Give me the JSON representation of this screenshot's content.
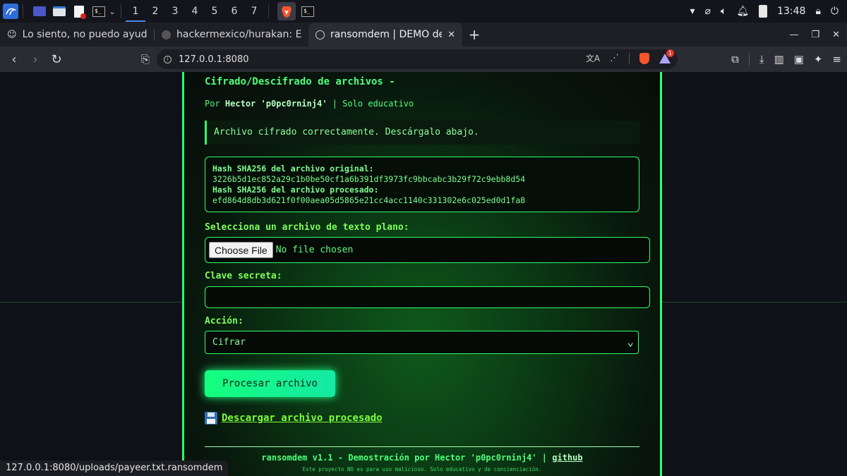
{
  "taskbar": {
    "workspaces": [
      "1",
      "2",
      "3",
      "4",
      "5",
      "6",
      "7"
    ],
    "clock": "13:48"
  },
  "tabs": [
    {
      "label": "Lo siento, no puedo ayudar co",
      "icon": "bot-icon"
    },
    {
      "label": "hackermexico/hurakan: Es un",
      "icon": "github-icon"
    },
    {
      "label": "ransomdem | DEMO de cif",
      "icon": "globe-icon",
      "active": true
    }
  ],
  "address": {
    "url": "127.0.0.1:8080",
    "notification_count": "1"
  },
  "page": {
    "title": "Cifrado/Descifrado de archivos -",
    "by_prefix": "Por",
    "author": "Hector 'p0pc0rninj4'",
    "by_suffix": "| Solo educativo",
    "success_message": "Archivo cifrado correctamente. Descárgalo abajo.",
    "hash_original_label": "Hash SHA256 del archivo original:",
    "hash_original": "3226b5d1ec852a29c1b0be50cf1a6b391df3973fc9bbcabc3b29f72c9ebb8d54",
    "hash_processed_label": "Hash SHA256 del archivo procesado:",
    "hash_processed": "efd864d8db3d621f0f00aea05d5865e21cc4acc1140c331302e6c025ed0d1fa8",
    "file_label": "Selecciona un archivo de texto plano:",
    "choose_file": "Choose File",
    "no_file": "No file chosen",
    "key_label": "Clave secreta:",
    "key_value": "",
    "action_label": "Acción:",
    "action_selected": "Cifrar",
    "process_button": "Procesar archivo",
    "download_link": "Descargar archivo procesado",
    "footer_main": "ransomdem v1.1 - Demostración por Hector 'p0pc0rninj4' |",
    "footer_link": "github",
    "footer_note": "Este proyecto NO es para uso malicioso. Solo educativo y de concienciación."
  },
  "status_url": "127.0.0.1:8080/uploads/payeer.txt.ransomdem",
  "colors": {
    "accent": "#33ff66",
    "button_gradient_start": "#15ff7e",
    "button_gradient_end": "#13e9a3"
  }
}
